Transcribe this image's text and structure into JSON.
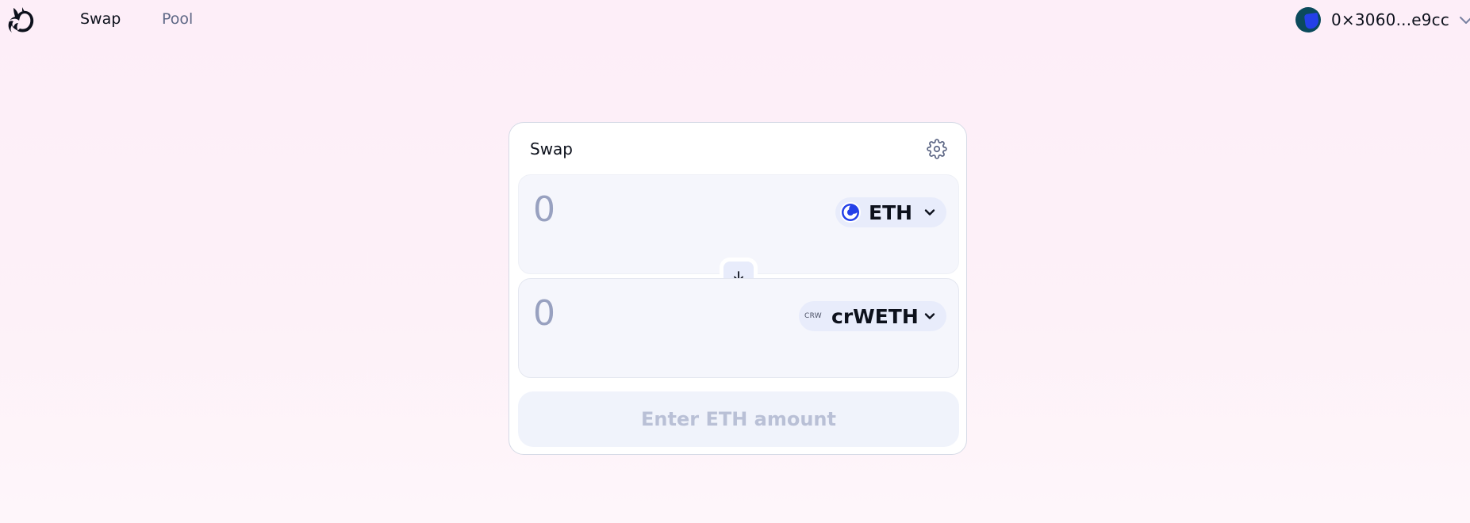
{
  "header": {
    "nav": [
      {
        "label": "Swap",
        "active": true
      },
      {
        "label": "Pool",
        "active": false
      }
    ],
    "account": {
      "address": "0×3060...e9cc",
      "avatar_color": "#0b4a5c"
    }
  },
  "swap_card": {
    "title": "Swap",
    "from": {
      "amount_placeholder": "0",
      "token_symbol": "ETH",
      "token_icon": "eth-icon"
    },
    "to": {
      "amount_placeholder": "0",
      "token_symbol": "crWETH",
      "token_icon_text": "CRW"
    },
    "submit_label": "Enter ETH amount"
  },
  "colors": {
    "background": "#fdeef8",
    "card": "#ffffff",
    "panel": "#f5f6fc",
    "token_pill": "#e8ecfb",
    "muted_text": "#98a1c0",
    "disabled_button_text": "#b9c0d6",
    "accent_blue": "#2440e8"
  }
}
